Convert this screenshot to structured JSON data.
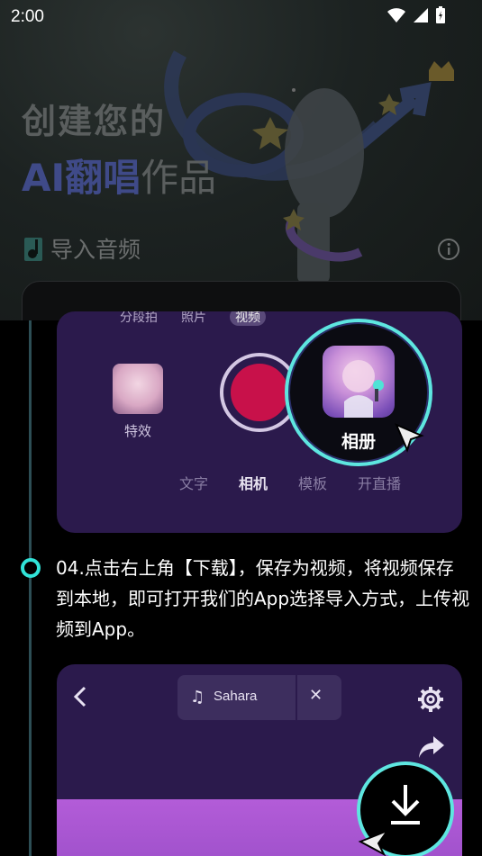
{
  "status_bar": {
    "time": "2:00"
  },
  "hero": {
    "title_line1": "创建您的",
    "title_ai": "AI翻唱",
    "title_rest": "作品"
  },
  "import": {
    "label": "导入音频"
  },
  "card1": {
    "modes": [
      "分段拍",
      "照片",
      "视频"
    ],
    "effect_label": "特效",
    "tabs": [
      "文字",
      "相机",
      "模板",
      "开直播"
    ],
    "album_label": "相册"
  },
  "step": {
    "text": "04.点击右上角【下载】，保存为视频，将视频保存到本地，即可打开我们的App选择导入方式，上传视频到App。"
  },
  "card2": {
    "music_name": "Sahara",
    "music_icon": "♫",
    "close_glyph": "✕"
  },
  "colors": {
    "accent": "#31e3d8",
    "card_bg": "#2b1a4c",
    "record_red": "#c8114a"
  }
}
